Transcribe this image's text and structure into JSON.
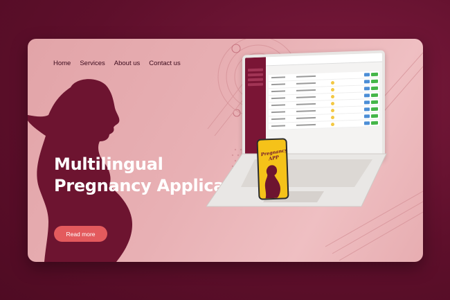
{
  "nav": {
    "items": [
      "Home",
      "Services",
      "About us",
      "Contact us"
    ]
  },
  "hero": {
    "title_line1": "Multilingual",
    "title_line2": "Pregnancy Application",
    "cta_label": "Read more"
  },
  "phone": {
    "app_title_line1": "Pregnancy",
    "app_title_line2": "APP"
  },
  "colors": {
    "background": "#5e0f2b",
    "card": "#e8b0b4",
    "accent": "#e35a5d",
    "silhouette": "#6d1430",
    "app_yellow": "#f5c219"
  }
}
